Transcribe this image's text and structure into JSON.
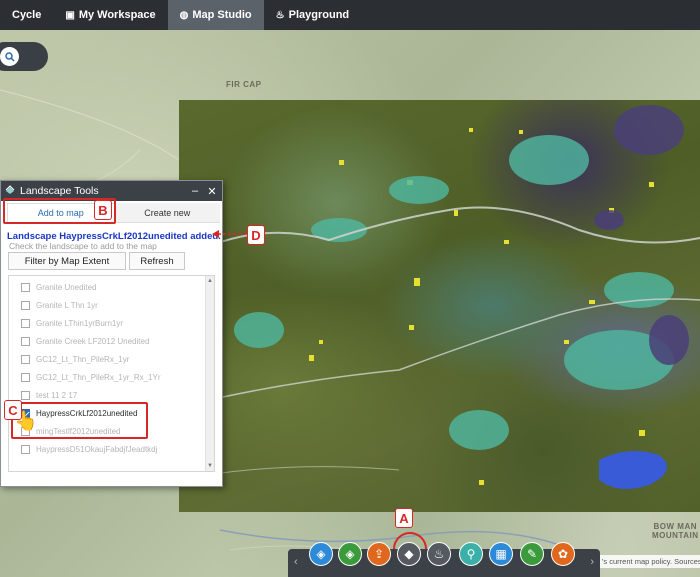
{
  "nav": {
    "items": [
      {
        "label": "Cycle",
        "icon": "cycle-icon",
        "active": false
      },
      {
        "label": "My Workspace",
        "icon": "workspace-icon",
        "active": false
      },
      {
        "label": "Map Studio",
        "icon": "globe-icon",
        "active": true
      },
      {
        "label": "Playground",
        "icon": "fire-icon",
        "active": false
      }
    ]
  },
  "map": {
    "labels": {
      "fir": "FIR\nCAP",
      "bowman": "BOW MAN\nMOUNTAIN"
    },
    "policy_text": "'s current map policy. Sources"
  },
  "panel": {
    "title": "Landscape Tools",
    "tabs": [
      "Add to map",
      "Create new"
    ],
    "active_tab": "Add to map",
    "added_message": "Landscape HaypressCrkLf2012unedited added.",
    "hint": "Check the landscape to add to the map",
    "filter_button": "Filter by Map Extent",
    "refresh_button": "Refresh",
    "items": [
      {
        "label": "Granite Unedited",
        "checked": false
      },
      {
        "label": "Granite L Thn 1yr",
        "checked": false
      },
      {
        "label": "Granite LThin1yrBurn1yr",
        "checked": false
      },
      {
        "label": "Granite Creek LF2012 Unedited",
        "checked": false
      },
      {
        "label": "GC12_Lt_Thn_PileRx_1yr",
        "checked": false
      },
      {
        "label": "GC12_Lt_Thn_PileRx_1yr_Rx_1Yr",
        "checked": false
      },
      {
        "label": "test 11 2 17",
        "checked": false
      },
      {
        "label": "HaypressCrkLf2012unedited",
        "checked": true
      },
      {
        "label": "mingTestlf2012unedited",
        "checked": false
      },
      {
        "label": "HaypressD51OkaujFabdjfJeadtkdj",
        "checked": false
      }
    ]
  },
  "annotations": {
    "a": "A",
    "b": "B",
    "c": "C",
    "d": "D"
  },
  "toolbar": {
    "tools": [
      {
        "name": "layers-icon",
        "color": "#2d8ad8"
      },
      {
        "name": "basemap-layers-icon",
        "color": "#3b9a3b"
      },
      {
        "name": "upload-icon",
        "color": "#e0681e"
      },
      {
        "name": "landscape-icon",
        "color": "#555a60"
      },
      {
        "name": "fire-tool-icon",
        "color": "#555a60"
      },
      {
        "name": "map-pin-icon",
        "color": "#3bb0a8"
      },
      {
        "name": "grid-icon",
        "color": "#2d8ad8"
      },
      {
        "name": "pencil-icon",
        "color": "#3b9a3b"
      },
      {
        "name": "palette-icon",
        "color": "#e0681e"
      }
    ]
  }
}
